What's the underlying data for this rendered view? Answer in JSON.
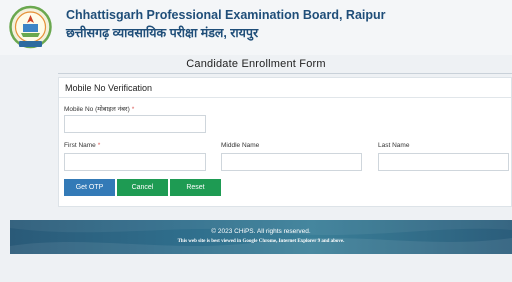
{
  "header": {
    "org_name_en": "Chhattisgarh Professional Examination Board, Raipur",
    "org_name_hi": "छत्तीसगढ़ व्यावसायिक परीक्षा मंडल, रायपुर",
    "logo_icon": "vyapam-emblem-icon"
  },
  "form": {
    "title": "Candidate Enrollment Form",
    "section_title": "Mobile No Verification",
    "mobile_label": "Mobile No (मोबाइल नंबर)",
    "mobile_value": "",
    "first_name_label": "First Name",
    "first_name_value": "",
    "middle_name_label": "Middle Name",
    "middle_name_value": "",
    "last_name_label": "Last Name",
    "last_name_value": "",
    "required_mark": "*"
  },
  "buttons": {
    "get_otp": "Get OTP",
    "cancel": "Cancel",
    "reset": "Reset"
  },
  "footer": {
    "copyright": "© 2023 CHiPS. All rights reserved.",
    "browser_note": "This web site is best viewed in Google Chrome, Internet Explorer 9 and above."
  },
  "colors": {
    "brand_blue": "#1f4e79",
    "primary_button": "#337ab7",
    "success_button": "#1e9b53",
    "footer_bg": "#2f6e8c",
    "required": "#d9534f"
  }
}
